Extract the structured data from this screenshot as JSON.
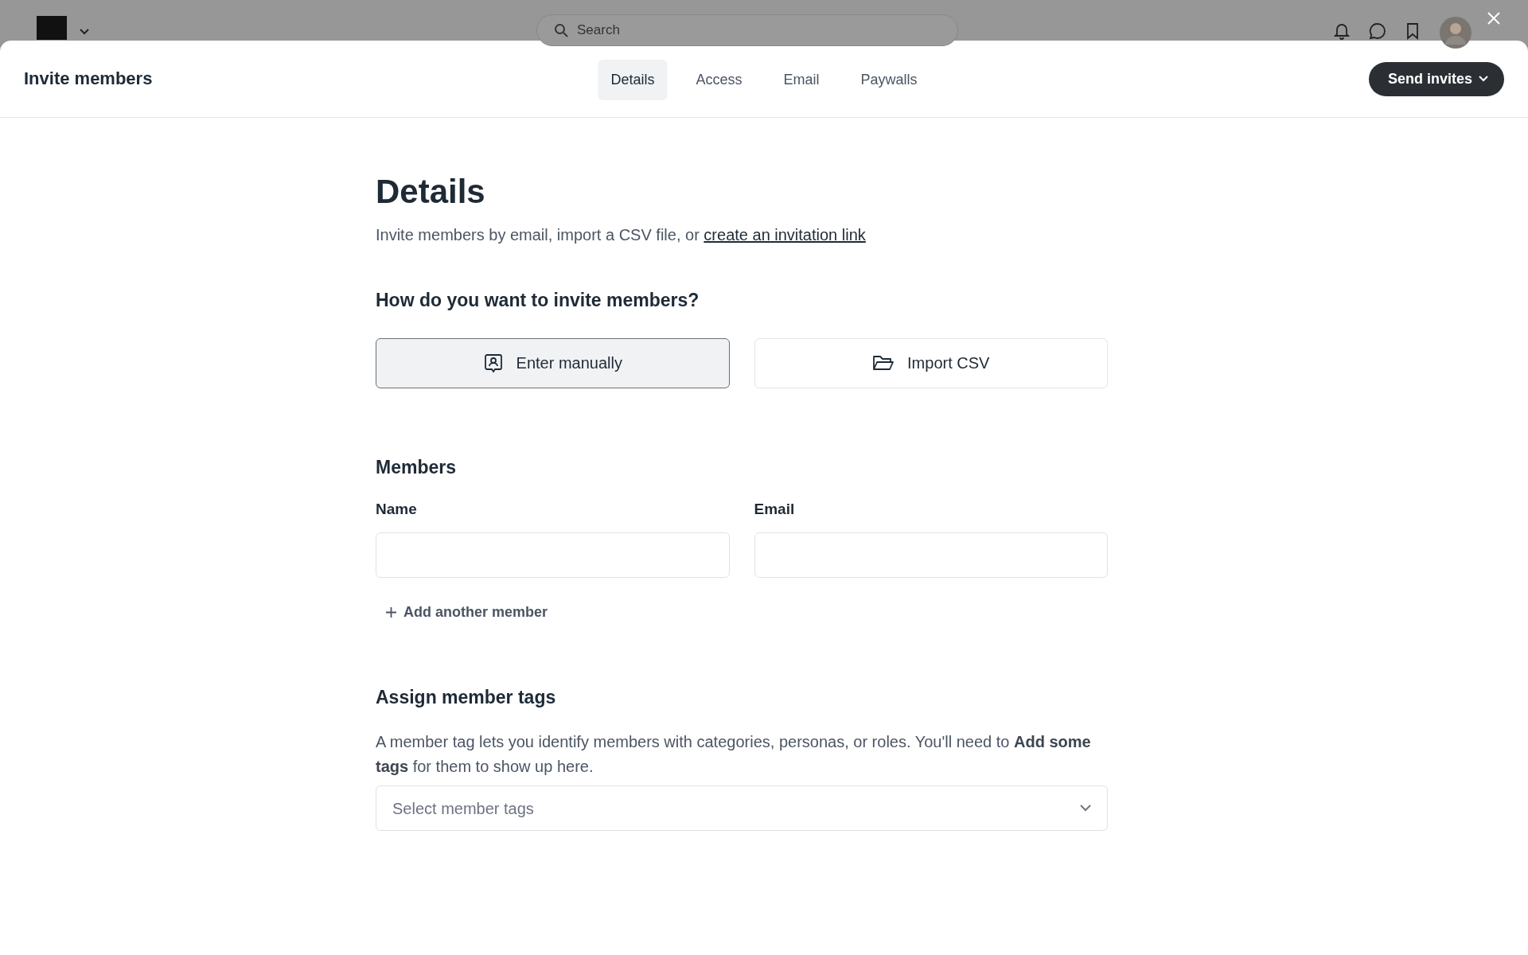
{
  "app_bar": {
    "search": {
      "placeholder": "Search"
    }
  },
  "modal": {
    "title": "Invite members",
    "tabs": [
      {
        "label": "Details",
        "selected": true
      },
      {
        "label": "Access",
        "selected": false
      },
      {
        "label": "Email",
        "selected": false
      },
      {
        "label": "Paywalls",
        "selected": false
      }
    ],
    "primary_button": "Send invites"
  },
  "page": {
    "heading": "Details",
    "intro": "Invite members by email, import a CSV file, or",
    "intro_link": "create an invitation link",
    "method_question": "How do you want to invite members?",
    "methods": [
      {
        "label": "Enter manually",
        "kind": "manual",
        "selected": true
      },
      {
        "label": "Import CSV",
        "kind": "csv",
        "selected": false
      }
    ],
    "members": {
      "heading": "Members",
      "fields": [
        {
          "label": "Name"
        },
        {
          "label": "Email"
        }
      ],
      "add_link": "Add another member"
    },
    "tags": {
      "heading": "Assign member tags",
      "description": "A member tag lets you identify members with categories, personas, or roles. You'll need to **Add some tags** for them to show up here.",
      "select": {
        "placeholder": "Select member tags"
      }
    }
  }
}
